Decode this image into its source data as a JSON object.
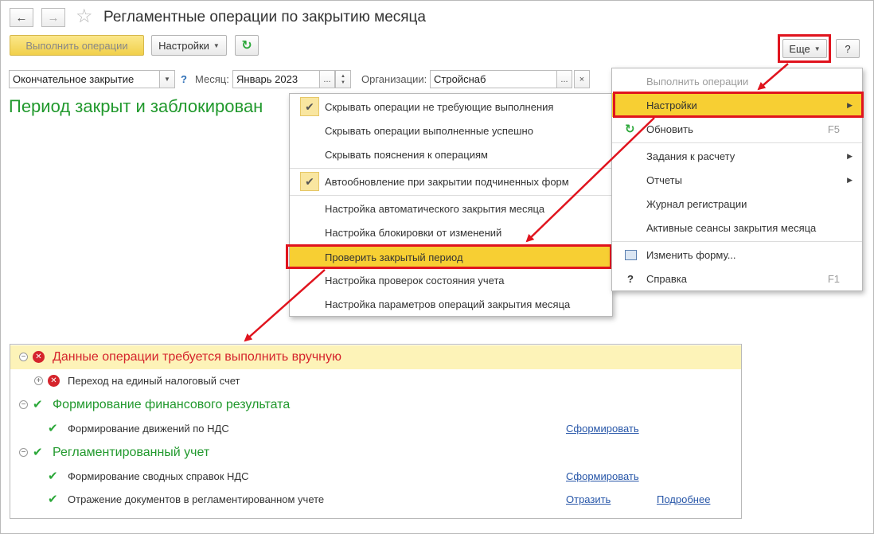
{
  "window": {
    "title": "Регламентные операции по закрытию месяца"
  },
  "toolbar": {
    "execute_label": "Выполнить операции",
    "settings_label": "Настройки",
    "more_label": "Еще",
    "help_label": "?"
  },
  "form": {
    "mode_value": "Окончательное закрытие",
    "help_q": "?",
    "month_label": "Месяц:",
    "month_value": "Январь 2023",
    "org_label": "Организации:",
    "org_value": "Стройснаб",
    "choose_label": "...",
    "clear_label": "×"
  },
  "status": {
    "period_text": "Период закрыт и заблокирован"
  },
  "more_menu": {
    "items": [
      {
        "label": "Выполнить операции"
      },
      {
        "label": "Настройки"
      },
      {
        "label": "Обновить",
        "shortcut": "F5"
      },
      {
        "label": "Задания к расчету"
      },
      {
        "label": "Отчеты"
      },
      {
        "label": "Журнал регистрации"
      },
      {
        "label": "Активные сеансы закрытия месяца"
      },
      {
        "label": "Изменить форму..."
      },
      {
        "label": "Справка",
        "shortcut": "F1"
      }
    ],
    "help_glyph": "?"
  },
  "settings_menu": {
    "items": [
      {
        "label": "Скрывать операции не требующие выполнения",
        "checked": true
      },
      {
        "label": "Скрывать операции выполненные успешно",
        "checked": false
      },
      {
        "label": "Скрывать пояснения к операциям",
        "checked": false
      },
      {
        "label": "Автообновление при закрытии подчиненных форм",
        "checked": true
      },
      {
        "label": "Настройка автоматического закрытия месяца"
      },
      {
        "label": "Настройка блокировки от изменений"
      },
      {
        "label": "Проверить закрытый период"
      },
      {
        "label": "Настройка проверок состояния учета"
      },
      {
        "label": "Настройка параметров операций закрытия месяца"
      }
    ]
  },
  "results": {
    "groups": [
      {
        "title": "Данные операции требуется выполнить вручную",
        "status": "error",
        "rows": [
          {
            "label": "Переход на единый налоговый счет"
          }
        ]
      },
      {
        "title": "Формирование финансового результата",
        "status": "ok",
        "rows": [
          {
            "label": "Формирование движений по НДС",
            "action": "Сформировать"
          }
        ]
      },
      {
        "title": "Регламентированный учет",
        "status": "ok",
        "rows": [
          {
            "label": "Формирование сводных справок НДС",
            "action": "Сформировать"
          },
          {
            "label": "Отражение документов в регламентированном учете",
            "action": "Отразить",
            "action2": "Подробнее"
          }
        ]
      }
    ]
  },
  "colors": {
    "accent_yellow": "#f7cf33",
    "status_green": "#21992d",
    "error_red": "#d5242c",
    "annotation_red": "#e0141e",
    "link_blue": "#2756a8"
  }
}
